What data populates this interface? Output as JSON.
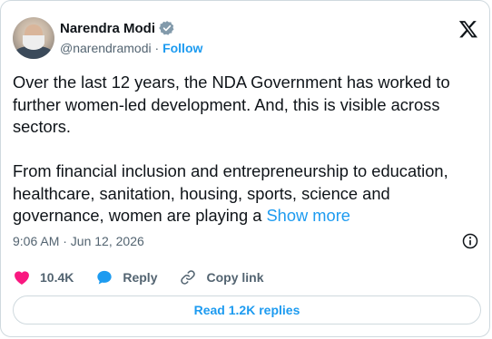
{
  "author": {
    "name": "Narendra Modi",
    "handle": "@narendramodi",
    "separator": "·",
    "follow_label": "Follow"
  },
  "tweet": {
    "paragraph_1": "Over the last 12 years, the NDA Government has worked to further women-led development. And, this is visible across sectors.",
    "paragraph_2": "From financial inclusion and entrepreneurship to education, healthcare, sanitation, housing, sports, science and governance, women are playing a",
    "show_more_label": "Show more"
  },
  "timestamp": "9:06 AM · Jun 12, 2026",
  "actions": {
    "likes": "10.4K",
    "reply_label": "Reply",
    "copy_link_label": "Copy link"
  },
  "read_replies_label": "Read 1.2K replies",
  "colors": {
    "accent": "#1d9bf0",
    "like": "#f91880",
    "text": "#0f1419",
    "secondary": "#536471"
  }
}
